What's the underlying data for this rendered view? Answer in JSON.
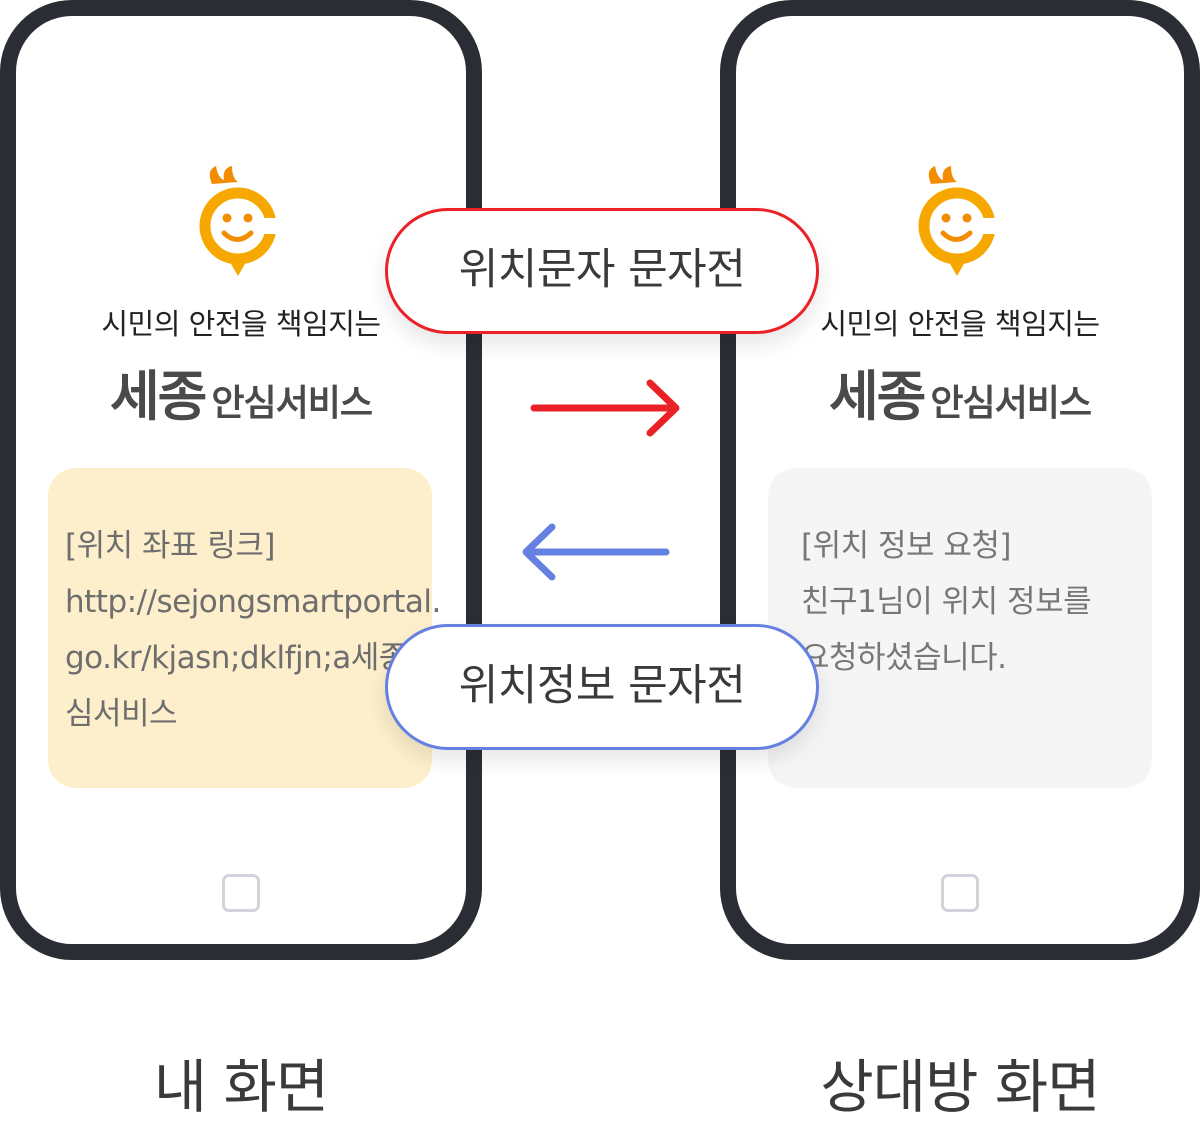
{
  "left_phone": {
    "tagline": "시민의 안전을 책임지는",
    "brand_main": "세종",
    "brand_sub": "안심서비스",
    "message_lines": [
      "[위치 좌표 링크]",
      "http://sejongsmartportal.",
      "go.kr/kjasn;dklfjn;a세종안",
      "심서비스"
    ]
  },
  "right_phone": {
    "tagline": "시민의 안전을 책임지는",
    "brand_main": "세종",
    "brand_sub": "안심서비스",
    "message_lines": [
      "[위치 정보 요청]",
      "친구1님이 위치 정보를",
      "요청하셨습니다."
    ]
  },
  "pill_top": "위치문자 문자전",
  "pill_bottom": "위치정보 문자전",
  "caption_left": "내 화면",
  "caption_right": "상대방 화면",
  "colors": {
    "phone_frame": "#2a2d33",
    "red_accent": "#ea2127",
    "blue_accent": "#6480e0",
    "mascot_orange": "#f7a800",
    "left_bubble": "#fdefcb",
    "right_bubble": "#f5f5f5"
  },
  "icons": {
    "mascot": "smiling-mascot-icon",
    "right_arrow": "arrow-right-icon",
    "left_arrow": "arrow-left-icon",
    "home": "home-button-icon"
  }
}
